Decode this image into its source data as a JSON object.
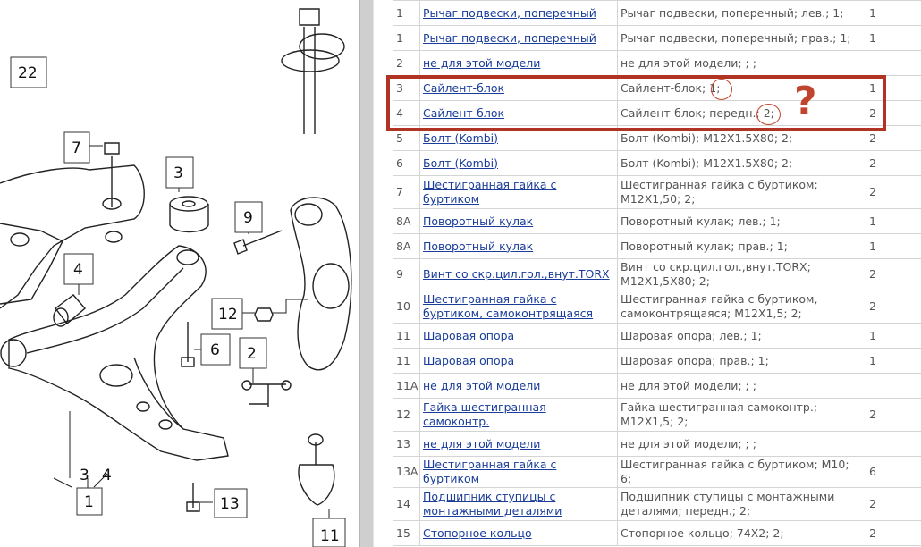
{
  "diagram": {
    "callouts": [
      "22",
      "7",
      "3",
      "9",
      "4",
      "12",
      "6",
      "2",
      "3",
      "4",
      "1",
      "13",
      "11"
    ]
  },
  "table": {
    "rows": [
      {
        "no": "1",
        "name": "Рычаг подвески, поперечный",
        "desc": "Рычаг подвески, поперечный; лев.; 1;",
        "qty": "1"
      },
      {
        "no": "1",
        "name": "Рычаг подвески, поперечный",
        "desc": "Рычаг подвески, поперечный; прав.; 1;",
        "qty": "1"
      },
      {
        "no": "2",
        "name": "не для этой модели",
        "desc": "не для этой модели; ; ;",
        "qty": ""
      },
      {
        "no": "3",
        "name": "Сайлент-блок",
        "desc": "Сайлент-блок; 1;",
        "qty": "1"
      },
      {
        "no": "4",
        "name": "Сайлент-блок",
        "desc": "Сайлент-блок; передн.; 2;",
        "qty": "2"
      },
      {
        "no": "5",
        "name": "Болт (Kombi)",
        "desc": "Болт (Kombi); M12X1.5X80; 2;",
        "qty": "2"
      },
      {
        "no": "6",
        "name": "Болт (Kombi)",
        "desc": "Болт (Kombi); M12X1.5X80; 2;",
        "qty": "2"
      },
      {
        "no": "7",
        "name": "Шестигранная гайка с буртиком",
        "desc": "Шестигранная гайка с буртиком; M12X1,50; 2;",
        "qty": "2"
      },
      {
        "no": "8A",
        "name": "Поворотный кулак",
        "desc": "Поворотный кулак; лев.; 1;",
        "qty": "1"
      },
      {
        "no": "8A",
        "name": "Поворотный кулак",
        "desc": "Поворотный кулак; прав.; 1;",
        "qty": "1"
      },
      {
        "no": "9",
        "name": "Винт со скр.цил.гол.,внут.TORX",
        "desc": "Винт со скр.цил.гол.,внут.TORX; M12X1,5X80; 2;",
        "qty": "2"
      },
      {
        "no": "10",
        "name": "Шестигранная гайка с буртиком, самоконтрящаяся",
        "desc": "Шестигранная гайка с буртиком, самоконтрящаяся; M12X1,5; 2;",
        "qty": "2"
      },
      {
        "no": "11",
        "name": "Шаровая опора",
        "desc": "Шаровая опора; лев.; 1;",
        "qty": "1"
      },
      {
        "no": "11",
        "name": "Шаровая опора",
        "desc": "Шаровая опора; прав.; 1;",
        "qty": "1"
      },
      {
        "no": "11A",
        "name": "не для этой модели",
        "desc": "не для этой модели; ; ;",
        "qty": ""
      },
      {
        "no": "12",
        "name": "Гайка шестигранная самоконтр.",
        "desc": "Гайка шестигранная самоконтр.; M12X1,5; 2;",
        "qty": "2"
      },
      {
        "no": "13",
        "name": "не для этой модели",
        "desc": "не для этой модели; ; ;",
        "qty": ""
      },
      {
        "no": "13A",
        "name": "Шестигранная гайка с буртиком",
        "desc": "Шестигранная гайка с буртиком; M10; 6;",
        "qty": "6"
      },
      {
        "no": "14",
        "name": "Подшипник ступицы с монтажными деталями",
        "desc": "Подшипник ступицы с монтажными деталями; передн.; 2;",
        "qty": "2"
      },
      {
        "no": "15",
        "name": "Стопорное кольцо",
        "desc": "Стопорное кольцо; 74X2; 2;",
        "qty": "2"
      }
    ]
  },
  "annotation": {
    "question_mark": "?",
    "accent_color": "#b03323"
  }
}
